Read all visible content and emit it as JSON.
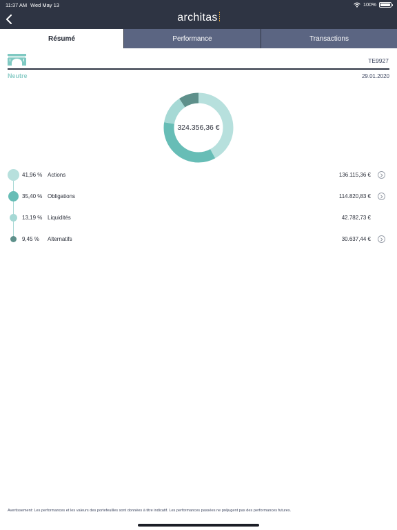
{
  "status_bar": {
    "time": "11:37 AM",
    "date": "Wed May 13",
    "battery": "100%"
  },
  "nav": {
    "brand": "architas"
  },
  "tabs": [
    {
      "label": "Résumé",
      "active": true
    },
    {
      "label": "Performance",
      "active": false
    },
    {
      "label": "Transactions",
      "active": false
    }
  ],
  "portfolio": {
    "code": "TE9927",
    "profile": "Neutre",
    "date": "29.01.2020"
  },
  "donut": {
    "total": "324.356,36 €"
  },
  "allocations": [
    {
      "percent": "41,96 %",
      "share": 41.96,
      "name": "Actions",
      "value": "136.115,36 €",
      "color": "#b7e0dd",
      "has_detail": true
    },
    {
      "percent": "35,40 %",
      "share": 35.4,
      "name": "Obligations",
      "value": "114.820,83 €",
      "color": "#67bdb6",
      "has_detail": true
    },
    {
      "percent": "13,19 %",
      "share": 13.19,
      "name": "Liquidités",
      "value": "42.782,73 €",
      "color": "#a6d9d5",
      "has_detail": false
    },
    {
      "percent": "9,45 %",
      "share": 9.45,
      "name": "Alternatifs",
      "value": "30.637,44 €",
      "color": "#5e908b",
      "has_detail": true
    }
  ],
  "colors": {
    "nav_background": "#2e3443",
    "tab_inactive": "#5b6582",
    "profile_accent": "#8ccdc8"
  },
  "icons": {
    "back": "chevron-left-icon",
    "portfolio": "bridge-icon",
    "wifi": "wifi-icon",
    "battery": "battery-icon",
    "detail": "chevron-right-circle-icon"
  },
  "disclaimer": "Avertissement: Les performances et les valeurs des portefeuilles sont données à titre indicatif. Les performances passées ne préjugent pas des performances futures."
}
